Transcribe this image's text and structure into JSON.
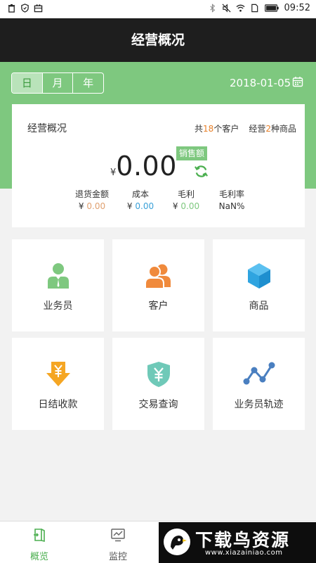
{
  "status_bar": {
    "time": "09:52",
    "left_icons": [
      "trash-icon",
      "shield-icon",
      "briefcase-icon"
    ],
    "right_icons": [
      "bluetooth-icon",
      "mute-icon",
      "wifi-icon",
      "sim-icon",
      "battery-icon"
    ]
  },
  "header": {
    "title": "经营概况"
  },
  "period": {
    "tabs": [
      "日",
      "月",
      "年"
    ],
    "active": "日",
    "date": "2018-01-05"
  },
  "summary": {
    "title": "经营概况",
    "customers_prefix": "共",
    "customers_count": "18",
    "customers_suffix": "个客户",
    "goods_prefix": "经营",
    "goods_count": "2",
    "goods_suffix": "种商品",
    "currency": "¥",
    "amount": "0.00",
    "badge": "销售额",
    "metrics": [
      {
        "label": "退货金额",
        "currency": "¥",
        "value": "0.00"
      },
      {
        "label": "成本",
        "currency": "¥",
        "value": "0.00"
      },
      {
        "label": "毛利",
        "currency": "¥",
        "value": "0.00"
      },
      {
        "label": "毛利率",
        "value": "NaN%"
      }
    ]
  },
  "tiles": [
    {
      "label": "业务员",
      "icon": "salesperson-icon"
    },
    {
      "label": "客户",
      "icon": "customers-icon"
    },
    {
      "label": "商品",
      "icon": "cube-icon"
    },
    {
      "label": "日结收款",
      "icon": "yen-down-arrow-icon"
    },
    {
      "label": "交易查询",
      "icon": "yen-shield-icon"
    },
    {
      "label": "业务员轨迹",
      "icon": "trajectory-icon"
    }
  ],
  "bottom_nav": [
    {
      "label": "概览",
      "icon": "overview-icon",
      "active": true
    },
    {
      "label": "监控",
      "icon": "monitor-icon",
      "active": false
    }
  ],
  "watermark": {
    "title": "下载鸟资源",
    "url": "www.xiazainiao.com"
  },
  "colors": {
    "accent_green": "#7ec87f",
    "header_dark": "#1e1e1e",
    "orange": "#e8812a",
    "blue": "#3aa0d8"
  }
}
